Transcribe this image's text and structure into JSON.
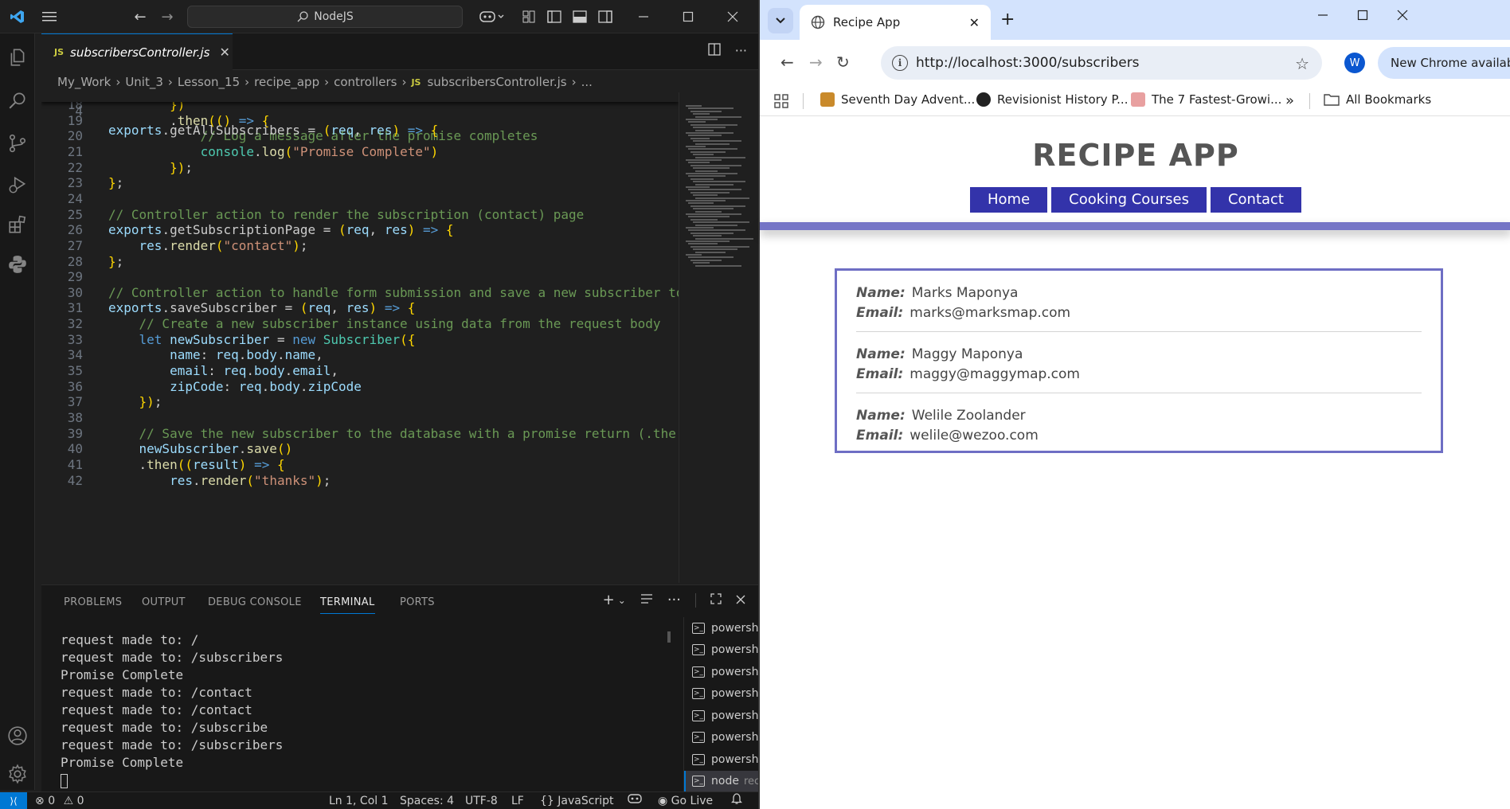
{
  "vscode": {
    "search_text": "NodeJS",
    "tab": {
      "badge": "JS",
      "filename": "subscribersController.js"
    },
    "breadcrumb": [
      "My_Work",
      "Unit_3",
      "Lesson_15",
      "recipe_app",
      "controllers",
      "subscribersController.js",
      "..."
    ],
    "breadcrumb_badge": "JS",
    "sticky_line": {
      "number": "4",
      "text": "exports.getAllSubscribers = (req, res) => {"
    },
    "code_lines": [
      {
        "n": "18",
        "text": "        })"
      },
      {
        "n": "19",
        "text": "        .then(() => {"
      },
      {
        "n": "20",
        "text": "            // Log a message after the promise completes"
      },
      {
        "n": "21",
        "text": "            console.log(\"Promise Complete\")"
      },
      {
        "n": "22",
        "text": "        });"
      },
      {
        "n": "23",
        "text": "};"
      },
      {
        "n": "24",
        "text": ""
      },
      {
        "n": "25",
        "text": "// Controller action to render the subscription (contact) page"
      },
      {
        "n": "26",
        "text": "exports.getSubscriptionPage = (req, res) => {"
      },
      {
        "n": "27",
        "text": "    res.render(\"contact\");"
      },
      {
        "n": "28",
        "text": "};"
      },
      {
        "n": "29",
        "text": ""
      },
      {
        "n": "30",
        "text": "// Controller action to handle form submission and save a new subscriber to"
      },
      {
        "n": "31",
        "text": "exports.saveSubscriber = (req, res) => {"
      },
      {
        "n": "32",
        "text": "    // Create a new subscriber instance using data from the request body"
      },
      {
        "n": "33",
        "text": "    let newSubscriber = new Subscriber({"
      },
      {
        "n": "34",
        "text": "        name: req.body.name,"
      },
      {
        "n": "35",
        "text": "        email: req.body.email,"
      },
      {
        "n": "36",
        "text": "        zipCode: req.body.zipCode"
      },
      {
        "n": "37",
        "text": "    });"
      },
      {
        "n": "38",
        "text": ""
      },
      {
        "n": "39",
        "text": "    // Save the new subscriber to the database with a promise return (.the"
      },
      {
        "n": "40",
        "text": "    newSubscriber.save()"
      },
      {
        "n": "41",
        "text": "    .then((result) => {"
      },
      {
        "n": "42",
        "text": "        res.render(\"thanks\");"
      }
    ],
    "panel_tabs": [
      "PROBLEMS",
      "OUTPUT",
      "DEBUG CONSOLE",
      "TERMINAL",
      "PORTS"
    ],
    "active_panel_tab": "TERMINAL",
    "terminal_lines": [
      "request made to: /",
      "request made to: /subscribers",
      "Promise Complete",
      "request made to: /contact",
      "request made to: /contact",
      "request made to: /subscribe",
      "request made to: /subscribers",
      "Promise Complete"
    ],
    "terminal_list": [
      {
        "name": "powershell...",
        "sub": ""
      },
      {
        "name": "powershell...",
        "sub": ""
      },
      {
        "name": "powershell...",
        "sub": ""
      },
      {
        "name": "powershell...",
        "sub": ""
      },
      {
        "name": "powershell...",
        "sub": ""
      },
      {
        "name": "powershell...",
        "sub": ""
      },
      {
        "name": "powershell...",
        "sub": ""
      },
      {
        "name": "node",
        "sub": "recipe..."
      }
    ],
    "status": {
      "errors": "0",
      "warnings": "0",
      "position": "Ln 1, Col 1",
      "spaces": "Spaces: 4",
      "encoding": "UTF-8",
      "eol": "LF",
      "language": "JavaScript",
      "golive": "Go Live"
    }
  },
  "chrome": {
    "tab_title": "Recipe App",
    "url": "http://localhost:3000/subscribers",
    "profile_initial": "W",
    "update_label": "New Chrome available",
    "bookmarks": [
      "Seventh Day Advent...",
      "Revisionist History P...",
      "The 7 Fastest-Growi..."
    ],
    "all_bookmarks": "All Bookmarks"
  },
  "app": {
    "title": "RECIPE APP",
    "nav": [
      "Home",
      "Cooking Courses",
      "Contact"
    ],
    "name_label": "Name:",
    "email_label": "Email:",
    "subscribers": [
      {
        "name": "Marks Maponya",
        "email": "marks@marksmap.com"
      },
      {
        "name": "Maggy Maponya",
        "email": "maggy@maggymap.com"
      },
      {
        "name": "Welile Zoolander",
        "email": "welile@wezoo.com"
      }
    ]
  },
  "colors": {
    "vscode_bg": "#1f1f1f",
    "vscode_accent": "#0078d4",
    "app_nav_bg": "#3333aa",
    "app_border": "#6e6ec4",
    "chrome_tabstrip": "#d3e3fd"
  }
}
